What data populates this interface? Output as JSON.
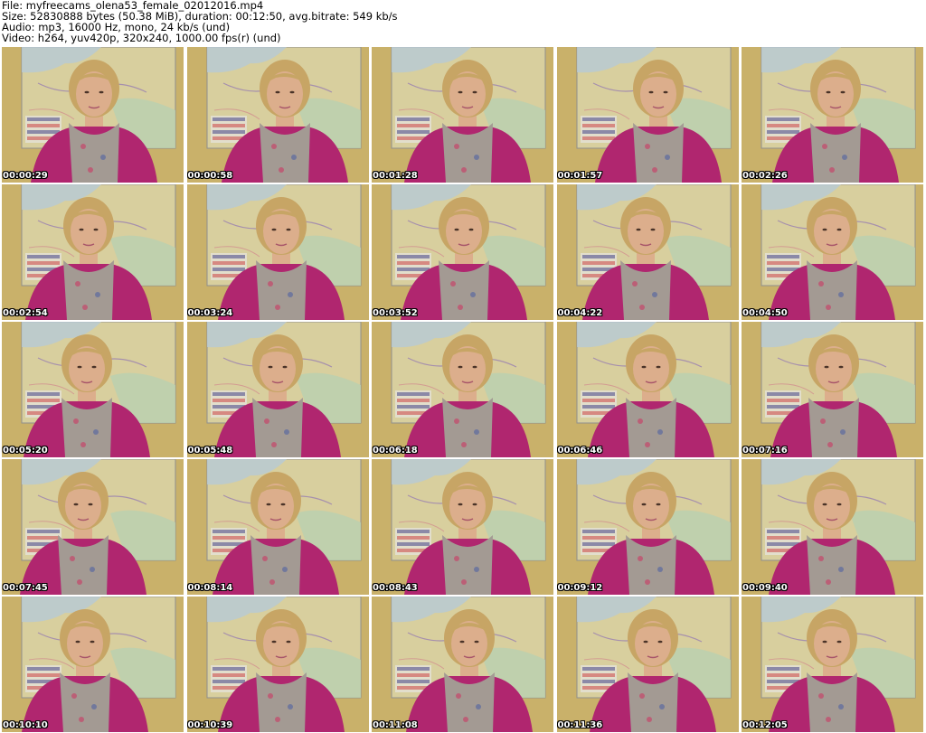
{
  "header": {
    "file_line": "File: myfreecams_olena53_female_02012016.mp4",
    "size_line": "Size: 52830888 bytes (50.38 MiB), duration: 00:12:50, avg.bitrate: 549 kb/s",
    "audio_line": "Audio: mp3, 16000 Hz, mono, 24 kb/s (und)",
    "video_line": "Video: h264, yuv420p, 320x240, 1000.00 fps(r) (und)"
  },
  "colors": {
    "wall": "#c9b16a",
    "map_sea": "#b7c9d6",
    "map_land": "#d8cf9e",
    "sweater": "#b0266f",
    "hair": "#c7a565",
    "skin": "#dcae8c",
    "scarf": "#a39a93"
  },
  "thumbnails": [
    {
      "timestamp": "00:00:29"
    },
    {
      "timestamp": "00:00:58"
    },
    {
      "timestamp": "00:01:28"
    },
    {
      "timestamp": "00:01:57"
    },
    {
      "timestamp": "00:02:26"
    },
    {
      "timestamp": "00:02:54"
    },
    {
      "timestamp": "00:03:24"
    },
    {
      "timestamp": "00:03:52"
    },
    {
      "timestamp": "00:04:22"
    },
    {
      "timestamp": "00:04:50"
    },
    {
      "timestamp": "00:05:20"
    },
    {
      "timestamp": "00:05:48"
    },
    {
      "timestamp": "00:06:18"
    },
    {
      "timestamp": "00:06:46"
    },
    {
      "timestamp": "00:07:16"
    },
    {
      "timestamp": "00:07:45"
    },
    {
      "timestamp": "00:08:14"
    },
    {
      "timestamp": "00:08:43"
    },
    {
      "timestamp": "00:09:12"
    },
    {
      "timestamp": "00:09:40"
    },
    {
      "timestamp": "00:10:10"
    },
    {
      "timestamp": "00:10:39"
    },
    {
      "timestamp": "00:11:08"
    },
    {
      "timestamp": "00:11:36"
    },
    {
      "timestamp": "00:12:05"
    }
  ]
}
